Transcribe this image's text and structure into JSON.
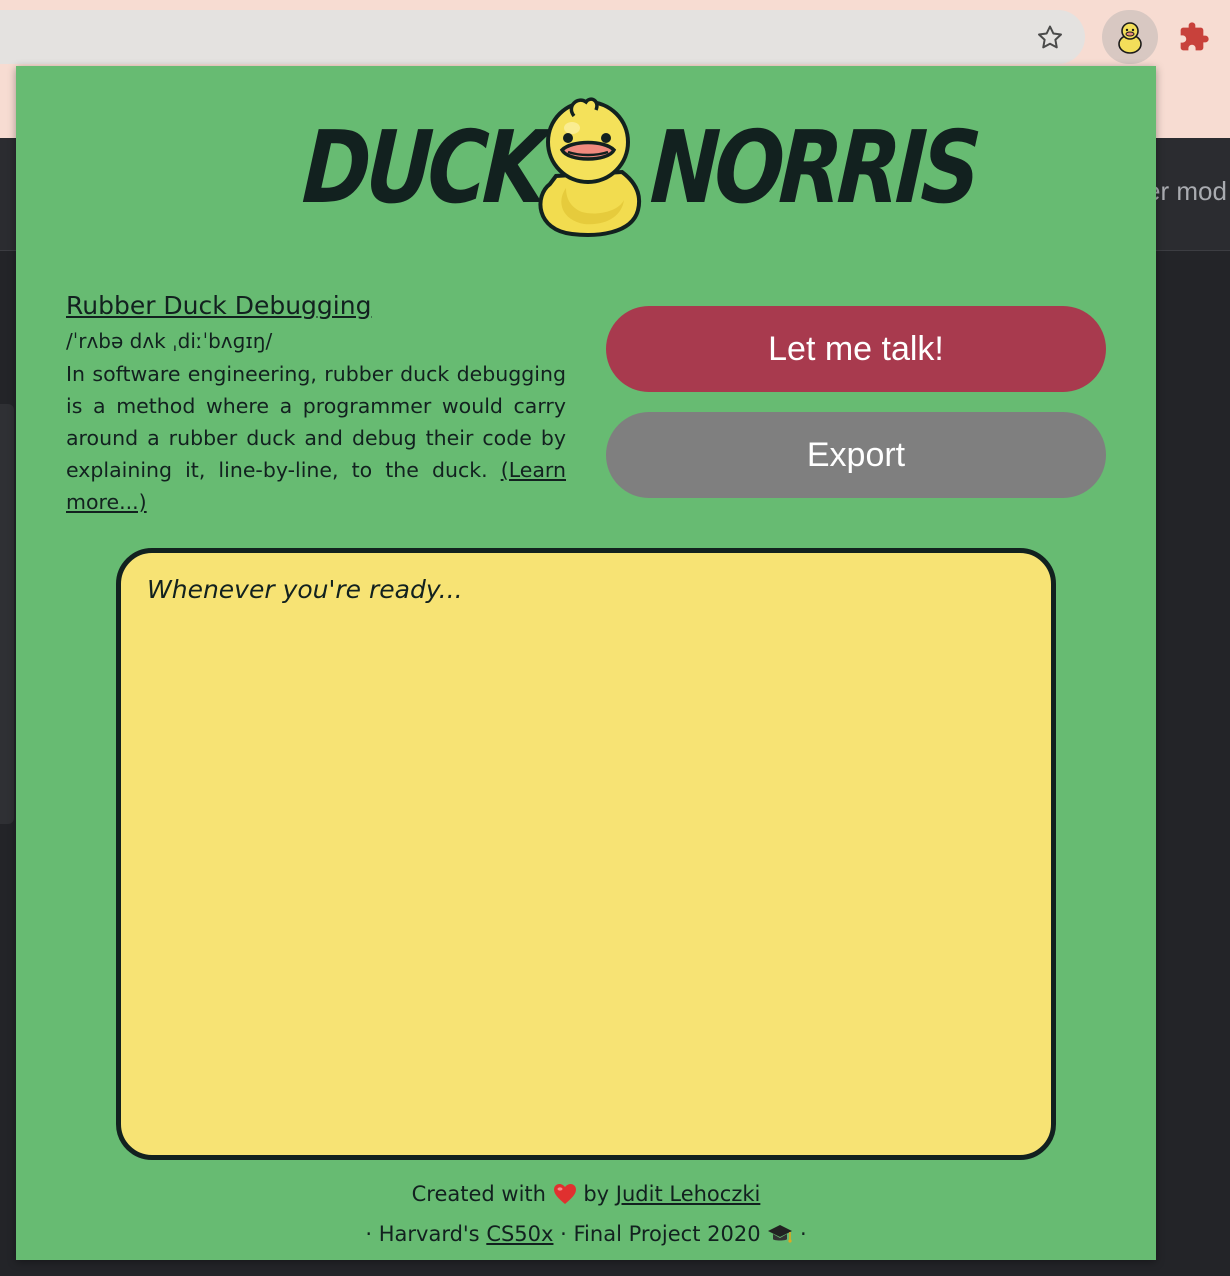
{
  "app": {
    "logo_word_1": "DUCK",
    "logo_word_2": "NORRIS"
  },
  "browser": {
    "icons": [
      "star-icon",
      "duck-extension-icon",
      "puzzle-icon"
    ],
    "background_partial_text": "er mod"
  },
  "definition": {
    "title": "Rubber Duck Debugging",
    "phonetic": "/ˈrʌbə dʌk ˌdiːˈbʌɡɪŋ/",
    "body": "In software engineering, rubber duck debugging is a method where a programmer would carry around a rubber duck and debug their code by explaining it, line-by-line, to the duck.",
    "learn_more": "(Learn more...)"
  },
  "actions": {
    "talk_label": "Let me talk!",
    "export_label": "Export"
  },
  "notes": {
    "placeholder": "Whenever you're ready...",
    "value": ""
  },
  "footer": {
    "line1_prefix": "Created with",
    "line1_by": "by",
    "author": "Judit Lehoczki",
    "line2_prefix": "· Harvard's",
    "course": "CS50x",
    "line2_suffix": "· Final Project 2020",
    "line2_end": "·"
  },
  "colors": {
    "popup_bg": "#67bb72",
    "talk_button": "#a83a4e",
    "export_button": "#7f7f7f",
    "notes_bg": "#f7e374",
    "text_dark": "#12211f"
  }
}
